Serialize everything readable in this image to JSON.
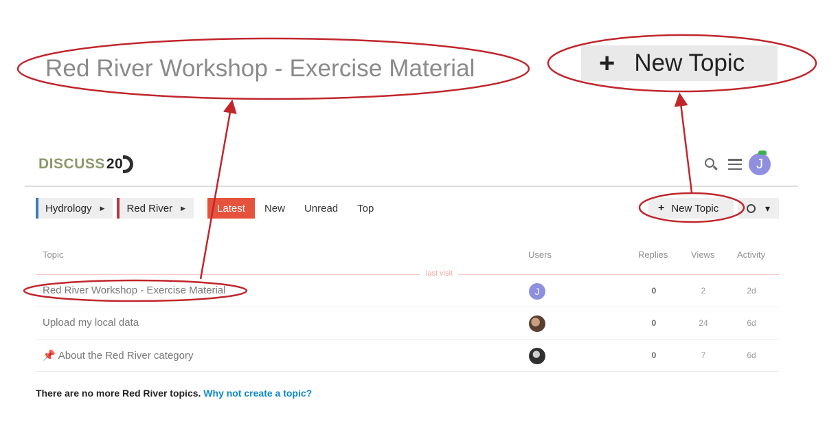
{
  "zoom": {
    "title": "Red River Workshop - Exercise Material",
    "new_topic_label": "New Topic",
    "plus": "+"
  },
  "header": {
    "logo_text": "DISCUSS",
    "logo_number": "20",
    "avatar_letter": "J"
  },
  "nav": {
    "crumbs": [
      {
        "label": "Hydrology",
        "color": "#3a7bbf"
      },
      {
        "label": "Red River",
        "color": "#c0343f"
      }
    ],
    "tabs": [
      "Latest",
      "New",
      "Unread",
      "Top"
    ],
    "active_tab": "Latest",
    "new_topic_label": "New Topic"
  },
  "table": {
    "headers": {
      "topic": "Topic",
      "users": "Users",
      "replies": "Replies",
      "views": "Views",
      "activity": "Activity"
    },
    "last_visit": "last visit",
    "rows": [
      {
        "title": "Red River Workshop - Exercise Material",
        "avatar": "J",
        "replies": "0",
        "views": "2",
        "activity": "2d"
      },
      {
        "title": "Upload my local data",
        "avatar": "",
        "replies": "0",
        "views": "24",
        "activity": "6d"
      },
      {
        "title": "About the Red River category",
        "avatar": "",
        "replies": "0",
        "views": "7",
        "activity": "6d",
        "pinned": true
      }
    ]
  },
  "footer": {
    "text": "There are no more Red River topics.",
    "link": "Why not create a topic?"
  },
  "colors": {
    "accent": "#e5533d",
    "link": "#0a87c9",
    "annotation": "#c0262c"
  }
}
